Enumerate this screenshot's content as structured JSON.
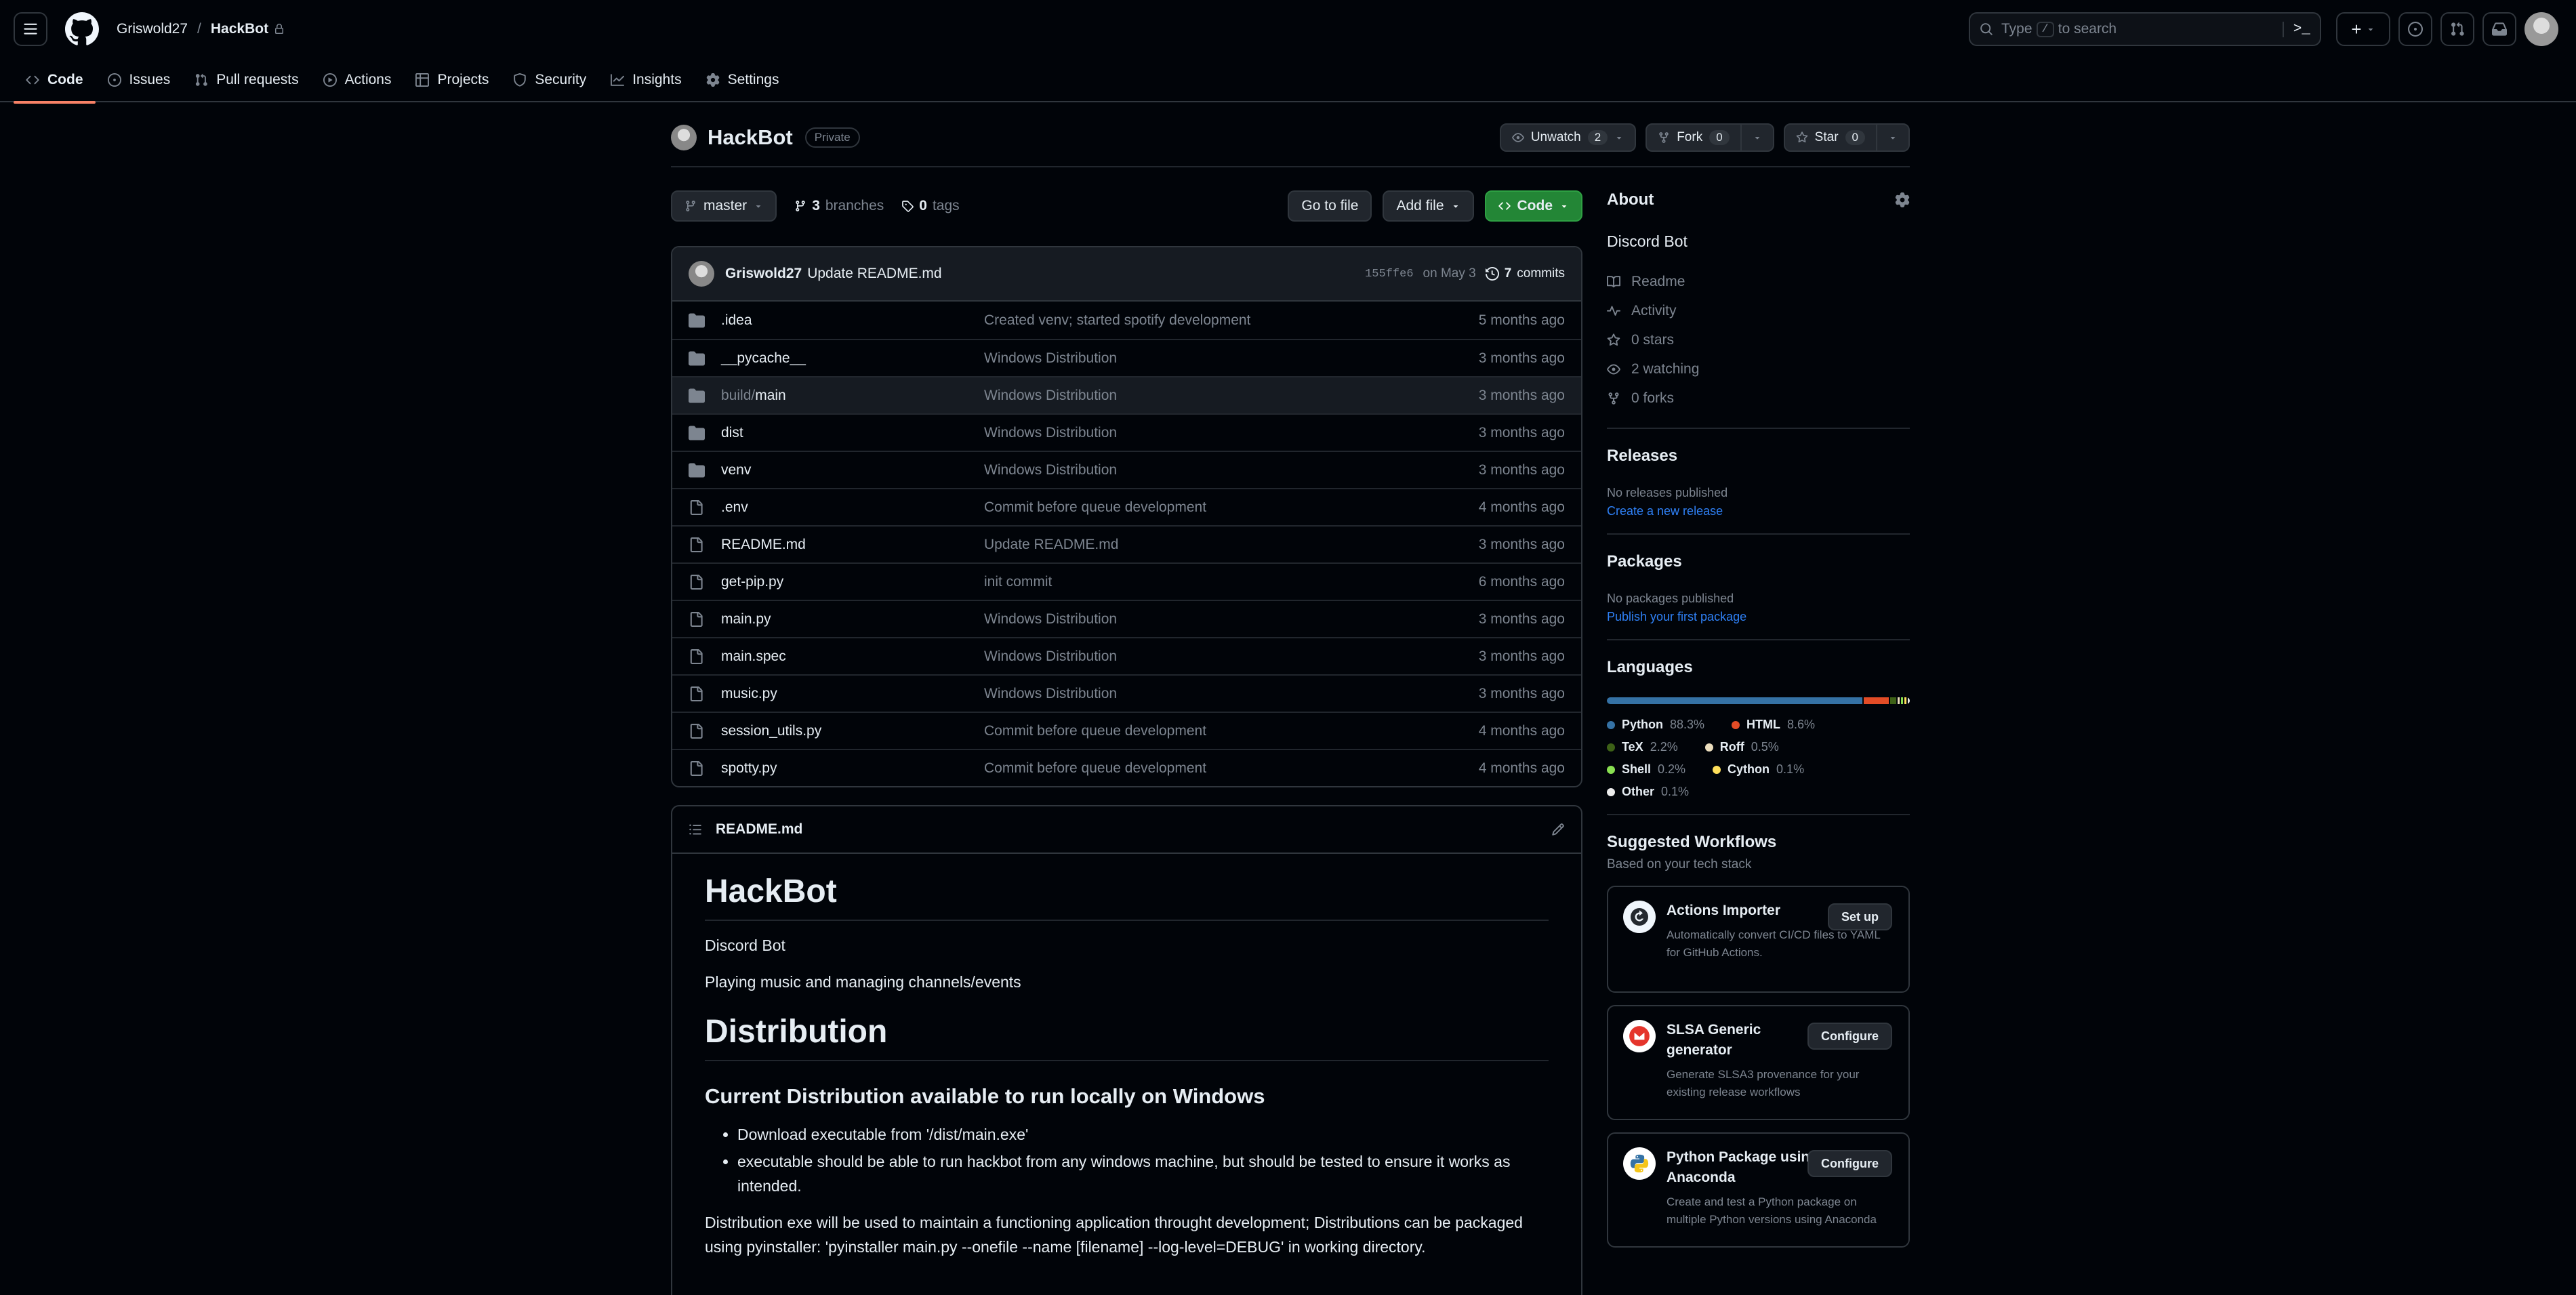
{
  "header": {
    "owner": "Griswold27",
    "separator": "/",
    "repo": "HackBot",
    "search": {
      "prefix": "Type",
      "slash": "/",
      "suffix": "to search",
      "cmd": ">_"
    },
    "plus": "+"
  },
  "nav": {
    "tabs": [
      {
        "label": "Code",
        "icon": "code-icon"
      },
      {
        "label": "Issues",
        "icon": "issue-icon"
      },
      {
        "label": "Pull requests",
        "icon": "pull-request-icon"
      },
      {
        "label": "Actions",
        "icon": "play-icon"
      },
      {
        "label": "Projects",
        "icon": "table-icon"
      },
      {
        "label": "Security",
        "icon": "shield-icon"
      },
      {
        "label": "Insights",
        "icon": "graph-icon"
      },
      {
        "label": "Settings",
        "icon": "gear-icon"
      }
    ]
  },
  "repo": {
    "name": "HackBot",
    "visibility": "Private",
    "unwatch_label": "Unwatch",
    "watch_count": "2",
    "fork_label": "Fork",
    "fork_count": "0",
    "star_label": "Star",
    "star_count": "0"
  },
  "toolbar": {
    "branch": "master",
    "branches_count": "3",
    "branches_label": "branches",
    "tags_count": "0",
    "tags_label": "tags",
    "go_to_file": "Go to file",
    "add_file": "Add file",
    "code": "Code"
  },
  "commit": {
    "author": "Griswold27",
    "message": "Update README.md",
    "hash": "155ffe6",
    "date": "on May 3",
    "commits_count": "7",
    "commits_label": "commits"
  },
  "files": [
    {
      "type": "dir",
      "name": ".idea",
      "message": "Created venv; started spotify development",
      "age": "5 months ago"
    },
    {
      "type": "dir",
      "name": "__pycache__",
      "message": "Windows Distribution",
      "age": "3 months ago"
    },
    {
      "type": "dir",
      "name_dim": "build/",
      "name": "main",
      "message": "Windows Distribution",
      "age": "3 months ago"
    },
    {
      "type": "dir",
      "name": "dist",
      "message": "Windows Distribution",
      "age": "3 months ago"
    },
    {
      "type": "dir",
      "name": "venv",
      "message": "Windows Distribution",
      "age": "3 months ago"
    },
    {
      "type": "file",
      "name": ".env",
      "message": "Commit before queue development",
      "age": "4 months ago"
    },
    {
      "type": "file",
      "name": "README.md",
      "message": "Update README.md",
      "age": "3 months ago"
    },
    {
      "type": "file",
      "name": "get-pip.py",
      "message": "init commit",
      "age": "6 months ago"
    },
    {
      "type": "file",
      "name": "main.py",
      "message": "Windows Distribution",
      "age": "3 months ago"
    },
    {
      "type": "file",
      "name": "main.spec",
      "message": "Windows Distribution",
      "age": "3 months ago"
    },
    {
      "type": "file",
      "name": "music.py",
      "message": "Windows Distribution",
      "age": "3 months ago"
    },
    {
      "type": "file",
      "name": "session_utils.py",
      "message": "Commit before queue development",
      "age": "4 months ago"
    },
    {
      "type": "file",
      "name": "spotty.py",
      "message": "Commit before queue development",
      "age": "4 months ago"
    }
  ],
  "readme": {
    "filename": "README.md",
    "h1": "HackBot",
    "p1": "Discord Bot",
    "p2": "Playing music and managing channels/events",
    "h1b": "Distribution",
    "h2": "Current Distribution available to run locally on Windows",
    "li1": "Download executable from '/dist/main.exe'",
    "li2": "executable should be able to run hackbot from any windows machine, but should be tested to ensure it works as intended.",
    "p3": "Distribution exe will be used to maintain a functioning application throught development; Distributions can be packaged using pyinstaller: 'pyinstaller main.py --onefile --name [filename] --log-level=DEBUG' in working directory."
  },
  "about": {
    "title": "About",
    "description": "Discord Bot",
    "items": [
      {
        "label": "Readme",
        "icon": "book-icon"
      },
      {
        "label": "Activity",
        "icon": "pulse-icon"
      },
      {
        "label": "0 stars",
        "icon": "star-icon"
      },
      {
        "label": "2 watching",
        "icon": "eye-icon"
      },
      {
        "label": "0 forks",
        "icon": "fork-icon"
      }
    ]
  },
  "releases": {
    "title": "Releases",
    "empty": "No releases published",
    "link": "Create a new release"
  },
  "packages": {
    "title": "Packages",
    "empty": "No packages published",
    "link": "Publish your first package"
  },
  "languages": {
    "title": "Languages",
    "items": [
      {
        "name": "Python",
        "pct": "88.3%",
        "value": 88.3,
        "color": "#3572A5"
      },
      {
        "name": "HTML",
        "pct": "8.6%",
        "value": 8.6,
        "color": "#e34c26"
      },
      {
        "name": "TeX",
        "pct": "2.2%",
        "value": 2.2,
        "color": "#3D6117"
      },
      {
        "name": "Roff",
        "pct": "0.5%",
        "value": 0.5,
        "color": "#ecdebe"
      },
      {
        "name": "Shell",
        "pct": "0.2%",
        "value": 0.2,
        "color": "#89e051"
      },
      {
        "name": "Cython",
        "pct": "0.1%",
        "value": 0.1,
        "color": "#fedf5b"
      },
      {
        "name": "Other",
        "pct": "0.1%",
        "value": 0.1,
        "color": "#ededed"
      }
    ]
  },
  "workflows": {
    "title": "Suggested Workflows",
    "subtitle": "Based on your tech stack",
    "items": [
      {
        "name": "Actions Importer",
        "button": "Set up",
        "desc": "Automatically convert CI/CD files to YAML for GitHub Actions."
      },
      {
        "name": "SLSA Generic generator",
        "button": "Configure",
        "desc": "Generate SLSA3 provenance for your existing release workflows"
      },
      {
        "name": "Python Package using Anaconda",
        "button": "Configure",
        "desc": "Create and test a Python package on multiple Python versions using Anaconda"
      }
    ]
  }
}
